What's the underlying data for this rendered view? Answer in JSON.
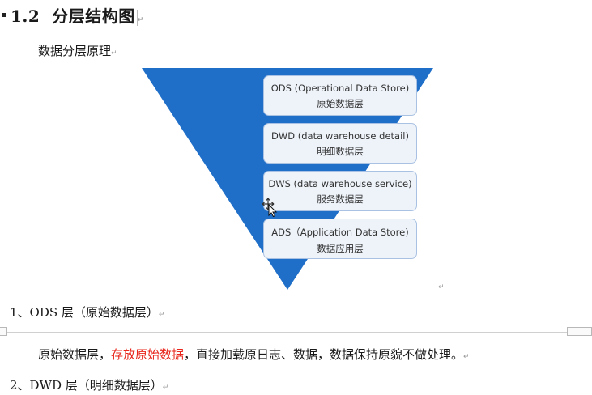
{
  "heading": {
    "number": "1.2",
    "title": "分层结构图"
  },
  "subheading": "数据分层原理",
  "diagram": {
    "triangle_color": "#1f6fc9",
    "layers": [
      {
        "en": "ODS (Operational Data Store)",
        "cn": "原始数据层"
      },
      {
        "en": "DWD (data warehouse detail)",
        "cn": "明细数据层"
      },
      {
        "en": "DWS (data warehouse service)",
        "cn": "服务数据层"
      },
      {
        "en": "ADS（Application Data Store)",
        "cn": "数据应用层"
      }
    ]
  },
  "section1": {
    "title": "1、ODS 层（原始数据层）"
  },
  "paragraph1": {
    "before": "原始数据层，",
    "highlight": "存放原始数据",
    "after": "，直接加载原日志、数据，数据保持原貌不做处理。",
    "highlight_color": "#e8261c"
  },
  "section2": {
    "title": "2、DWD 层（明细数据层）"
  },
  "marks": {
    "paragraph": "↵"
  }
}
